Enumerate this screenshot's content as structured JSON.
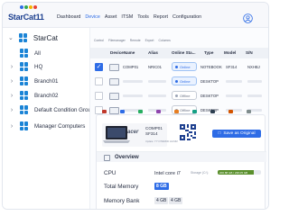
{
  "app": {
    "logo_text": "StarCat11",
    "logo_dot_colors": [
      "#2e6ce6",
      "#34a853",
      "#f4b400",
      "#ea4335"
    ]
  },
  "menu": [
    {
      "label": "Dashboard",
      "active": false
    },
    {
      "label": "Device",
      "active": true
    },
    {
      "label": "Asset",
      "active": false
    },
    {
      "label": "ITSM",
      "active": false
    },
    {
      "label": "Tools",
      "active": false
    },
    {
      "label": "Report",
      "active": false
    },
    {
      "label": "Configuration",
      "active": false
    }
  ],
  "sidebar": {
    "root": "StarCat",
    "items": [
      {
        "label": "All"
      },
      {
        "label": "HQ"
      },
      {
        "label": "Branch01"
      },
      {
        "label": "Branch02"
      },
      {
        "label": "Default Condition Group"
      },
      {
        "label": "Manager Computers"
      }
    ]
  },
  "toolbar": [
    "Control",
    "Filemanager",
    "Remote",
    "Export",
    "Columns"
  ],
  "table": {
    "headers": [
      "DeviceName",
      "Alias",
      "Online Sta...",
      "Type",
      "Model",
      "S/N"
    ],
    "rows": [
      {
        "checked": true,
        "name": "COMP01",
        "alias": "NRIC01",
        "status": "Online",
        "type": "NOTEBOOK",
        "model": "SF314",
        "sn": "NXHBJ"
      },
      {
        "checked": false,
        "name": "",
        "alias": "",
        "status": "Online",
        "type": "DESKTOP",
        "model": "",
        "sn": ""
      },
      {
        "checked": false,
        "name": "",
        "alias": "",
        "status": "Offline",
        "type": "DESKTOP",
        "model": "",
        "sn": ""
      },
      {
        "checked": false,
        "name": "",
        "alias": "",
        "status": "Offline",
        "type": "DESKTOP",
        "model": "",
        "sn": ""
      }
    ]
  },
  "detail": {
    "brand": "acer",
    "device_name_line1": "COMP01",
    "device_name_line2": "SF314",
    "update_time": "Update: YYYY/MM/DD HH:MM",
    "save_label": "Save as Original",
    "overview_title": "Overview",
    "cpu_label": "CPU",
    "cpu_value": "Intel core i7",
    "storage_label": "Storage (C:\\)",
    "storage_text": "200.88 GB / 238.05 GB",
    "storage_used_percent": 84,
    "total_memory_label": "Total Memory",
    "total_memory_value": "8 GB",
    "memory_bank_label": "Memory Bank",
    "memory_bank_values": [
      "4 GB",
      "4 GB"
    ]
  }
}
